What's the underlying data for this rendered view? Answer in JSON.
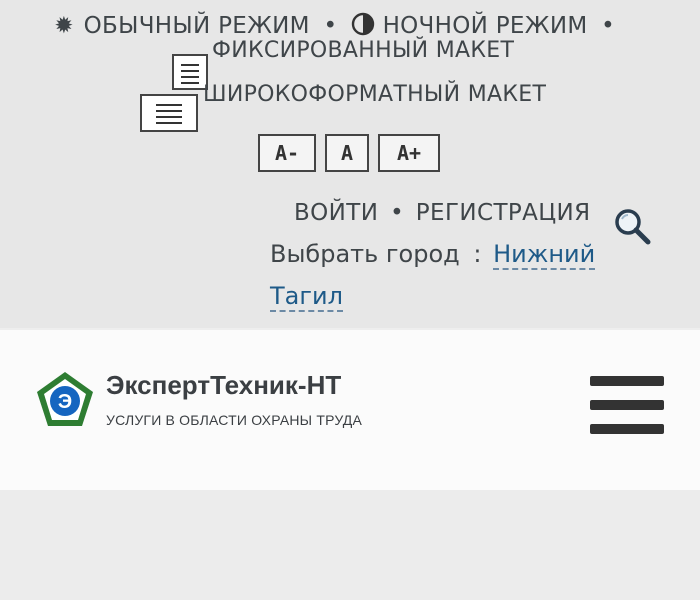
{
  "top_controls": {
    "normal_mode": "ОБЫЧНЫЙ РЕЖИМ",
    "night_mode": "НОЧНОЙ РЕЖИМ",
    "separator": "•",
    "fixed_layout": "ФИКСИРОВАННЫЙ МАКЕТ",
    "wide_layout": "ШИРОКОФОРМАТНЫЙ МАКЕТ",
    "font_decrease": "A-",
    "font_normal": "A",
    "font_increase": "A+"
  },
  "auth": {
    "login": "ВОЙТИ",
    "separator": "•",
    "register": "РЕГИСТРАЦИЯ"
  },
  "city": {
    "label": "Выбрать город",
    "colon": ":",
    "value_line1": "Нижний",
    "value_line2": "Тагил"
  },
  "brand": {
    "name": "ЭкспертТехник-НТ",
    "subtitle": "УСЛУГИ В ОБЛАСТИ ОХРАНЫ ТРУДА",
    "logo_letter": "Э",
    "colors": {
      "logo_green": "#2e7d32",
      "logo_blue": "#1565c0"
    }
  },
  "icons": {
    "sun": "sun-icon",
    "moon": "moon-icon",
    "layout": "layout-icon",
    "search": "search-icon",
    "menu": "hamburger-menu-icon"
  }
}
